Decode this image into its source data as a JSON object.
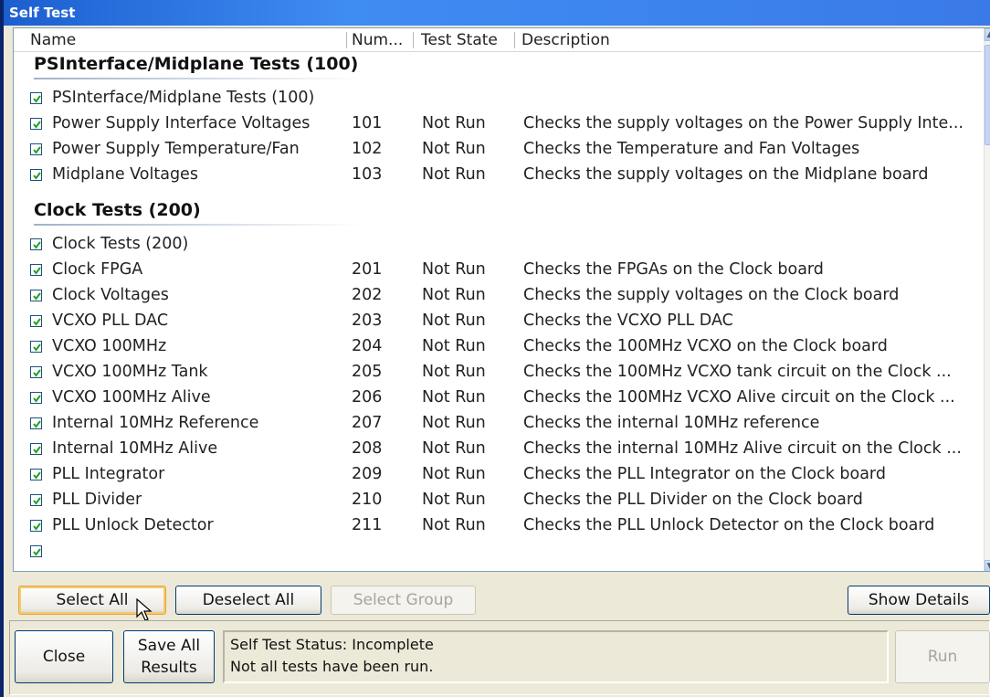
{
  "window": {
    "title": "Self Test"
  },
  "columns": {
    "name": "Name",
    "num": "Num...",
    "state": "Test State",
    "description": "Description"
  },
  "groups": [
    {
      "header": "PSInterface/Midplane Tests (100)",
      "rows": [
        {
          "name": "PSInterface/Midplane Tests (100)",
          "num": "",
          "state": "",
          "description": ""
        },
        {
          "name": "Power Supply Interface Voltages",
          "num": "101",
          "state": "Not Run",
          "description": "Checks the supply voltages on the Power Supply Inte..."
        },
        {
          "name": "Power Supply Temperature/Fan",
          "num": "102",
          "state": "Not Run",
          "description": "Checks the Temperature and Fan Voltages"
        },
        {
          "name": "Midplane Voltages",
          "num": "103",
          "state": "Not Run",
          "description": "Checks the supply voltages on the Midplane board"
        }
      ]
    },
    {
      "header": "Clock Tests (200)",
      "rows": [
        {
          "name": "Clock Tests (200)",
          "num": "",
          "state": "",
          "description": ""
        },
        {
          "name": "Clock FPGA",
          "num": "201",
          "state": "Not Run",
          "description": "Checks the FPGAs on the Clock board"
        },
        {
          "name": "Clock Voltages",
          "num": "202",
          "state": "Not Run",
          "description": "Checks the supply voltages on the Clock board"
        },
        {
          "name": "VCXO PLL DAC",
          "num": "203",
          "state": "Not Run",
          "description": "Checks the VCXO PLL DAC"
        },
        {
          "name": "VCXO 100MHz",
          "num": "204",
          "state": "Not Run",
          "description": "Checks the 100MHz VCXO on the Clock board"
        },
        {
          "name": "VCXO 100MHz Tank",
          "num": "205",
          "state": "Not Run",
          "description": "Checks the 100MHz VCXO tank circuit on the Clock ..."
        },
        {
          "name": "VCXO 100MHz Alive",
          "num": "206",
          "state": "Not Run",
          "description": "Checks the 100MHz VCXO Alive circuit on the Clock ..."
        },
        {
          "name": "Internal 10MHz Reference",
          "num": "207",
          "state": "Not Run",
          "description": "Checks the internal 10MHz reference"
        },
        {
          "name": "Internal 10MHz Alive",
          "num": "208",
          "state": "Not Run",
          "description": "Checks the internal 10MHz Alive circuit on the Clock ..."
        },
        {
          "name": "PLL Integrator",
          "num": "209",
          "state": "Not Run",
          "description": "Checks the PLL Integrator on the Clock board"
        },
        {
          "name": "PLL Divider",
          "num": "210",
          "state": "Not Run",
          "description": "Checks the PLL Divider on the Clock board"
        },
        {
          "name": "PLL Unlock Detector",
          "num": "211",
          "state": "Not Run",
          "description": "Checks the PLL Unlock Detector on the Clock board"
        }
      ]
    }
  ],
  "buttons": {
    "select_all": "Select All",
    "deselect_all": "Deselect All",
    "select_group": "Select Group",
    "show_details": "Show Details",
    "close": "Close",
    "save_all_line1": "Save All",
    "save_all_line2": "Results",
    "run": "Run"
  },
  "status": {
    "line1": "Self Test Status: Incomplete",
    "line2": "Not all tests have been run."
  },
  "colors": {
    "titlebar": "#3a7ae8",
    "window_bg": "#ece9d8",
    "checkbox_check": "#21a121"
  }
}
